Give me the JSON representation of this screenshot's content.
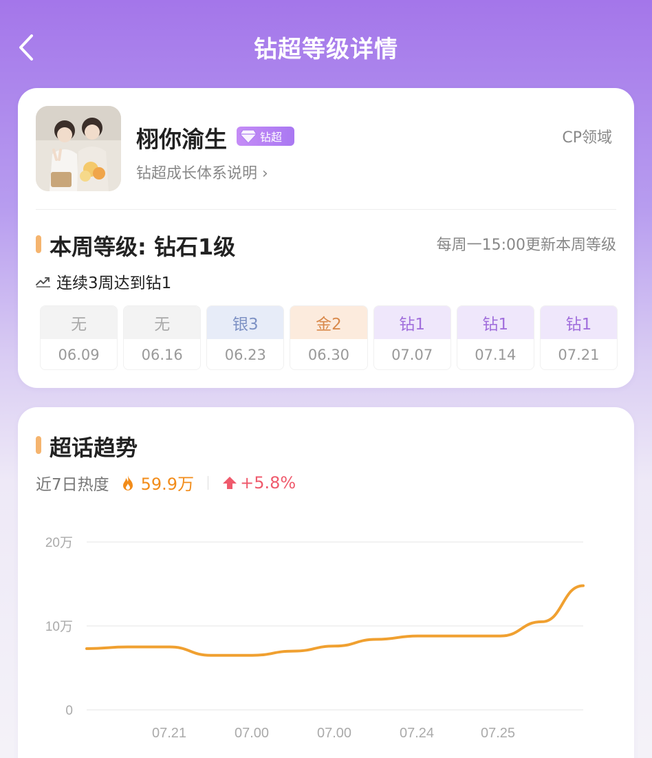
{
  "header": {
    "title": "钻超等级详情"
  },
  "profile": {
    "name": "栩你渝生",
    "badge": "钻超",
    "growth_link": "钻超成长体系说明",
    "domain": "CP领域"
  },
  "level": {
    "title": "本周等级: 钻石1级",
    "update_note": "每周一15:00更新本周等级",
    "streak": "连续3周达到钻1",
    "weeks": [
      {
        "level": "无",
        "date": "06.09",
        "tint": "#f3f3f3",
        "color": "#aaaaaa"
      },
      {
        "level": "无",
        "date": "06.16",
        "tint": "#f3f3f3",
        "color": "#aaaaaa"
      },
      {
        "level": "银3",
        "date": "06.23",
        "tint": "#e7ecf8",
        "color": "#7d91c4"
      },
      {
        "level": "金2",
        "date": "06.30",
        "tint": "#fcebdd",
        "color": "#d98a4c"
      },
      {
        "level": "钻1",
        "date": "07.07",
        "tint": "#efe7fb",
        "color": "#a16fdc"
      },
      {
        "level": "钻1",
        "date": "07.14",
        "tint": "#efe7fb",
        "color": "#a16fdc"
      },
      {
        "level": "钻1",
        "date": "07.21",
        "tint": "#efe7fb",
        "color": "#a16fdc"
      }
    ]
  },
  "trend": {
    "title": "超话趋势",
    "heat_label": "近7日热度",
    "heat_value": "59.9万",
    "change": "+5.8%"
  },
  "chart_data": {
    "type": "line",
    "y_ticks": [
      "20万",
      "10万",
      "0"
    ],
    "ylim": [
      0,
      20
    ],
    "x_ticks": [
      "07.21",
      "07.00",
      "07.00",
      "07.24",
      "07.25"
    ],
    "series": [
      {
        "color": "#f0a030",
        "x": [
          0,
          0.5,
          1,
          1.5,
          2,
          2.5,
          3,
          3.5,
          4,
          4.5,
          5,
          5.5,
          6
        ],
        "values": [
          7.3,
          7.5,
          7.5,
          6.5,
          6.5,
          7.0,
          7.6,
          8.4,
          8.8,
          8.8,
          8.8,
          10.5,
          14.8
        ]
      }
    ]
  }
}
